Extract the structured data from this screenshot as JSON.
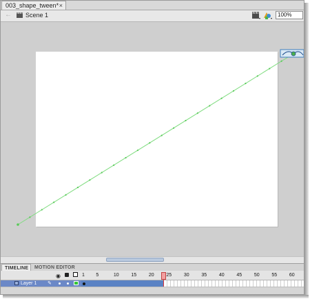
{
  "document_tab": {
    "title": "003_shape_tween*",
    "close_glyph": "×"
  },
  "edit_bar": {
    "back_icon": "back-arrow-icon",
    "scene_icon": "clapper-scene-icon",
    "scene_label": "Scene 1",
    "edit_scene_icon": "edit-scene-icon",
    "edit_symbols_icon": "edit-symbols-icon",
    "zoom_value": "100%"
  },
  "panel_tabs": {
    "timeline": "TIMELINE",
    "motion_editor": "MOTION EDITOR"
  },
  "timeline": {
    "frame_labels": [
      "1",
      "5",
      "10",
      "15",
      "20",
      "25",
      "30",
      "35",
      "40",
      "45",
      "50",
      "55",
      "60"
    ],
    "current_frame": 24,
    "tween_end_frame": 24,
    "layer_name": "Layer 1",
    "header_icons": [
      "eye-icon",
      "lock-icon",
      "outline-icon"
    ]
  },
  "colors": {
    "stage": "#ffffff",
    "pasteboard": "#cfcfcf",
    "motion_path": "#7fdc7f",
    "layer_highlight": "#6b88c7",
    "tween_span": "#5a82c4",
    "playhead": "#d33333"
  }
}
